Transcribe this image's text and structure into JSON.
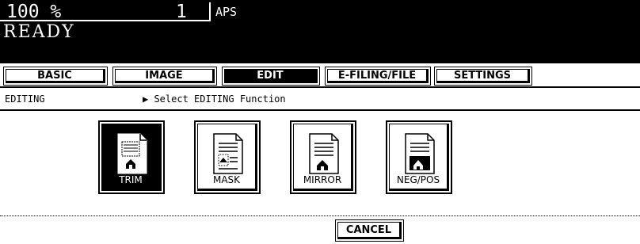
{
  "status_bar": {
    "zoom": "100 %",
    "copies": "1",
    "paper": "APS",
    "status": "READY"
  },
  "tabs": [
    {
      "label": "BASIC",
      "active": false
    },
    {
      "label": "IMAGE",
      "active": false
    },
    {
      "label": "EDIT",
      "active": true
    },
    {
      "label": "E-FILING/FILE",
      "active": false
    },
    {
      "label": "SETTINGS",
      "active": false
    }
  ],
  "breadcrumb": {
    "section": "EDITING",
    "instruction": "▶ Select EDITING Function"
  },
  "functions": [
    {
      "label": "TRIM",
      "icon": "trim-icon",
      "active": true
    },
    {
      "label": "MASK",
      "icon": "mask-icon",
      "active": false
    },
    {
      "label": "MIRROR",
      "icon": "mirror-icon",
      "active": false
    },
    {
      "label": "NEG/POS",
      "icon": "negpos-icon",
      "active": false
    }
  ],
  "cancel_label": "CANCEL"
}
